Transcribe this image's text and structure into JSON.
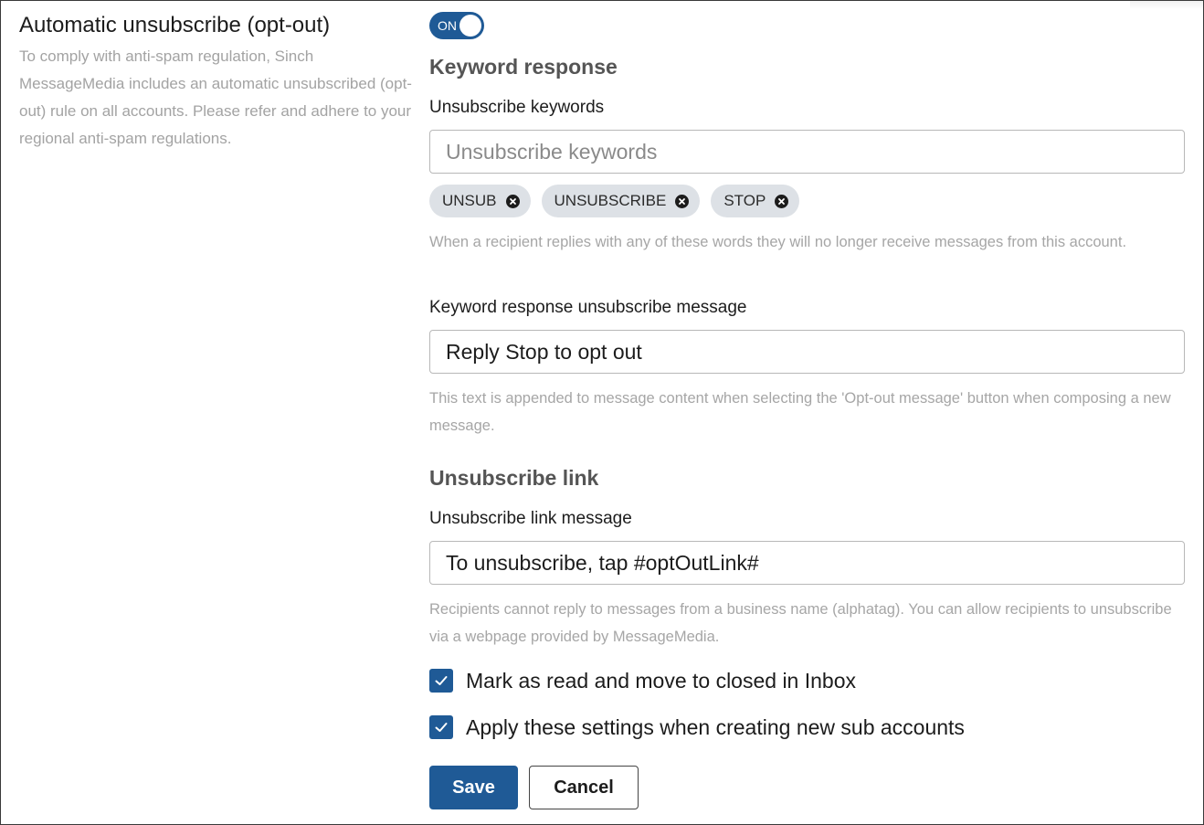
{
  "section": {
    "title": "Automatic unsubscribe (opt-out)",
    "description": "To comply with anti-spam regulation, Sinch MessageMedia includes an automatic unsubscribed (opt-out) rule on all accounts. Please refer and adhere to your regional anti-spam regulations."
  },
  "toggle": {
    "label": "ON",
    "state": "on"
  },
  "keyword_response": {
    "heading": "Keyword response",
    "keywords_label": "Unsubscribe keywords",
    "keywords_placeholder": "Unsubscribe keywords",
    "keywords_value": "",
    "chips": [
      {
        "label": "UNSUB"
      },
      {
        "label": "UNSUBSCRIBE"
      },
      {
        "label": "STOP"
      }
    ],
    "keywords_help": "When a recipient replies with any of these words they will no longer receive messages from this account.",
    "message_label": "Keyword response unsubscribe message",
    "message_value": "Reply Stop to opt out",
    "message_help": "This text is appended to message content when selecting the 'Opt-out message' button when composing a new message."
  },
  "unsubscribe_link": {
    "heading": "Unsubscribe link",
    "message_label": "Unsubscribe link message",
    "message_value": "To unsubscribe, tap #optOutLink#",
    "help": "Recipients cannot reply to messages from a business name (alphatag). You can allow recipients to unsubscribe via a webpage provided by MessageMedia."
  },
  "options": {
    "mark_read": {
      "label": "Mark as read and move to closed in Inbox",
      "checked": true
    },
    "apply_sub_accounts": {
      "label": "Apply these settings when creating new sub accounts",
      "checked": true
    }
  },
  "actions": {
    "save_label": "Save",
    "cancel_label": "Cancel"
  },
  "colors": {
    "accent": "#1f5a96",
    "chip_bg": "#dde1e6",
    "help_text": "#a6a6a6"
  }
}
